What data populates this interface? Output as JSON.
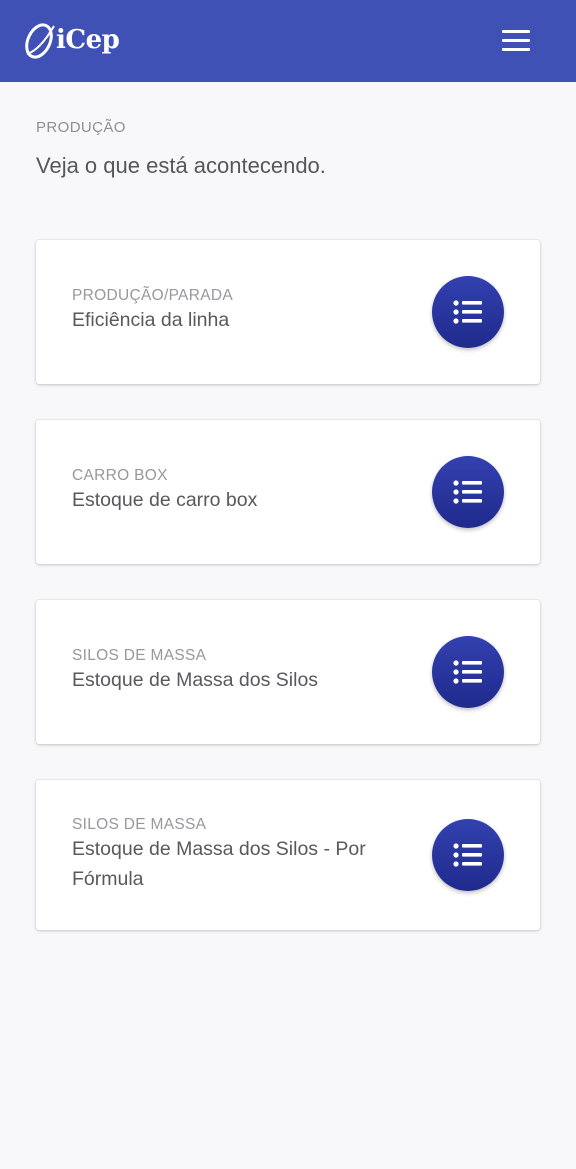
{
  "header": {
    "logo_text": "iCep",
    "menu_icon": "hamburger-menu-icon",
    "background_color": "#3f51b5"
  },
  "section": {
    "label": "PRODUÇÃO",
    "subtitle": "Veja o que está acontecendo."
  },
  "cards": [
    {
      "category": "PRODUÇÃO/PARADA",
      "title": "Eficiência da linha",
      "icon": "list-icon"
    },
    {
      "category": "CARRO BOX",
      "title": "Estoque de carro box",
      "icon": "list-icon"
    },
    {
      "category": "SILOS DE MASSA",
      "title": "Estoque de Massa dos Silos",
      "icon": "list-icon"
    },
    {
      "category": "SILOS DE MASSA",
      "title": "Estoque de Massa dos Silos - Por Fórmula",
      "icon": "list-icon"
    }
  ],
  "colors": {
    "accent": "#3f51b5",
    "button": "#2a3599"
  }
}
